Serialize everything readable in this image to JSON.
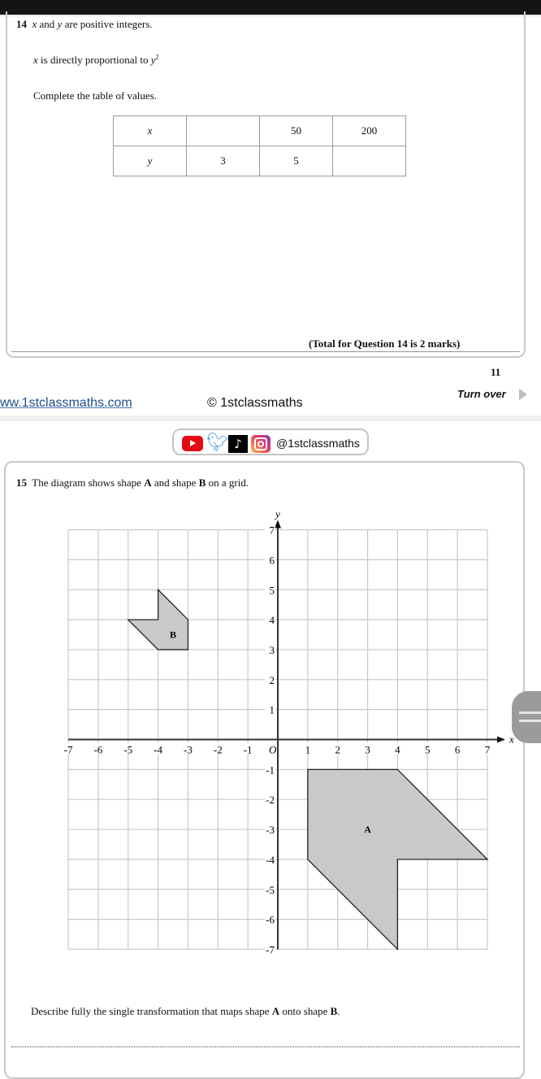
{
  "q14": {
    "number": "14",
    "line1_x": "x",
    "line1_rest": " and ",
    "line1_y": "y",
    "line1_end": " are positive integers.",
    "line2_x": "x",
    "line2_mid": " is directly proportional to ",
    "line2_y": "y",
    "line2_exp": "2",
    "line3": "Complete the table of values.",
    "table": {
      "rows": [
        {
          "label": "x",
          "cells": [
            "",
            "50",
            "200"
          ]
        },
        {
          "label": "y",
          "cells": [
            "3",
            "5",
            ""
          ]
        }
      ]
    },
    "total": "(Total for Question 14 is 2 marks)"
  },
  "footer": {
    "page_number": "11",
    "website": "ww.1stclassmaths.com",
    "copyright": "© 1stclassmaths",
    "turn_over": "Turn over"
  },
  "social": {
    "icons": [
      "youtube-icon",
      "twitter-icon",
      "tiktok-icon",
      "instagram-icon"
    ],
    "handle": "@1stclassmaths"
  },
  "q15": {
    "number": "15",
    "intro_pre": "The diagram shows shape ",
    "shape_a": "A",
    "intro_mid": " and shape ",
    "shape_b": "B",
    "intro_end": " on a grid.",
    "describe_pre": "Describe fully the single transformation that maps shape ",
    "describe_a": "A",
    "describe_mid": " onto shape ",
    "describe_b": "B",
    "describe_end": "."
  },
  "chart_data": {
    "type": "coordinate-grid",
    "xlim": [
      -7,
      7
    ],
    "ylim": [
      -7,
      7
    ],
    "xlabel": "x",
    "ylabel": "y",
    "origin_label": "O",
    "x_ticks": [
      -7,
      -6,
      -5,
      -4,
      -3,
      -2,
      -1,
      1,
      2,
      3,
      4,
      5,
      6,
      7
    ],
    "y_ticks": [
      7,
      6,
      5,
      4,
      3,
      2,
      1,
      -1,
      -2,
      -3,
      -4,
      -5,
      -6,
      -7
    ],
    "grid": true,
    "shapes": [
      {
        "label": "A",
        "vertices": [
          [
            1,
            -1
          ],
          [
            4,
            -1
          ],
          [
            7,
            -4
          ],
          [
            4,
            -4
          ],
          [
            4,
            -7
          ],
          [
            1,
            -4
          ]
        ],
        "label_at": [
          3,
          -3
        ]
      },
      {
        "label": "B",
        "vertices": [
          [
            -4,
            5
          ],
          [
            -3,
            4
          ],
          [
            -3,
            3
          ],
          [
            -4,
            3
          ],
          [
            -5,
            4
          ],
          [
            -4,
            4
          ]
        ],
        "label_at": [
          -3.5,
          3.5
        ]
      }
    ],
    "fill": "#c9c9c9"
  }
}
